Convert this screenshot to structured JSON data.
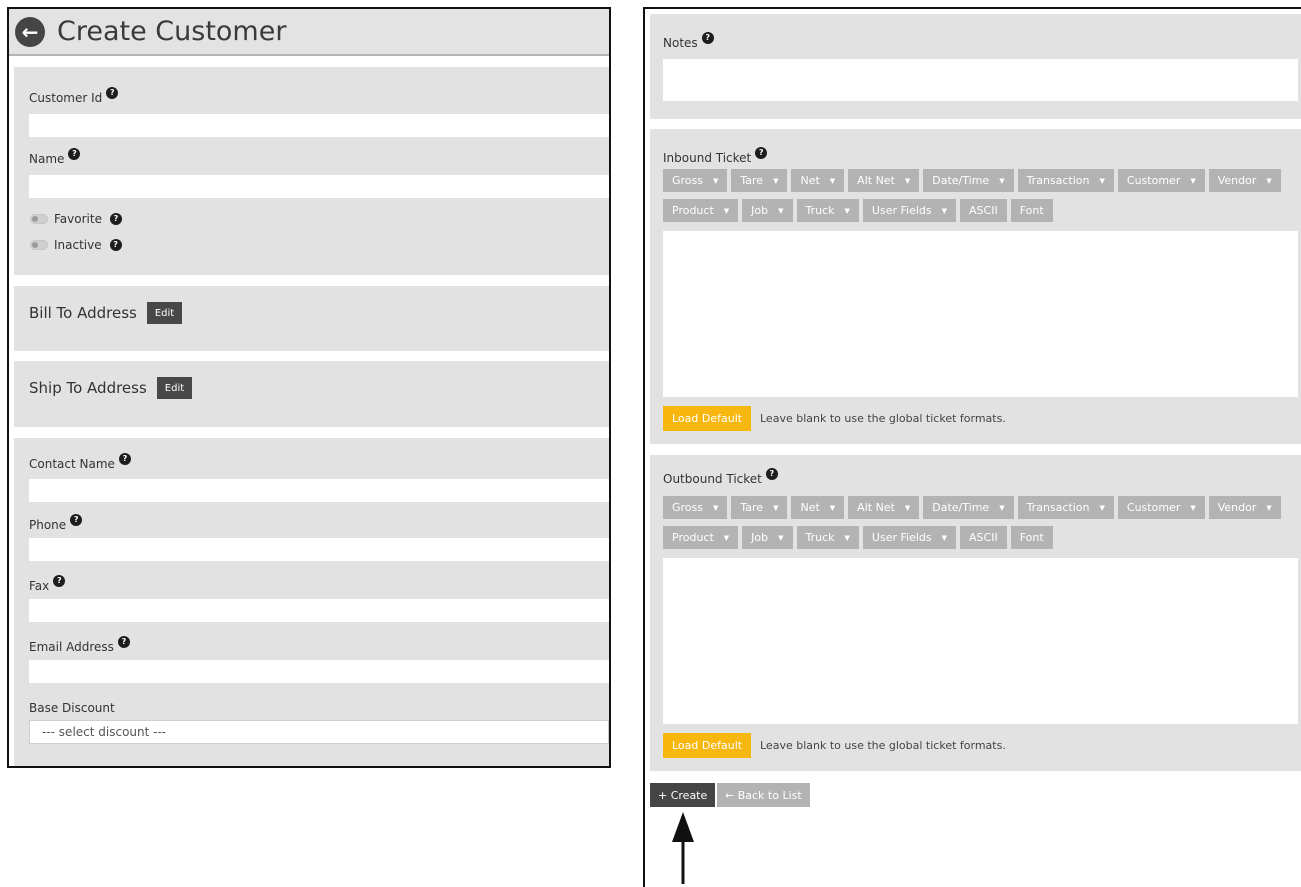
{
  "header": {
    "title": "Create Customer",
    "back_icon": "arrow-left-circle-icon"
  },
  "general": {
    "customer_id_label": "Customer Id",
    "name_label": "Name",
    "favorite_label": "Favorite",
    "inactive_label": "Inactive",
    "customer_id_value": "",
    "name_value": ""
  },
  "bill_to": {
    "title": "Bill To Address",
    "edit_label": "Edit"
  },
  "ship_to": {
    "title": "Ship To Address",
    "edit_label": "Edit"
  },
  "contact": {
    "contact_name_label": "Contact Name",
    "phone_label": "Phone",
    "fax_label": "Fax",
    "email_label": "Email Address",
    "base_discount_label": "Base Discount",
    "discount_selected": "--- select discount ---"
  },
  "notes": {
    "label": "Notes"
  },
  "inbound": {
    "label": "Inbound Ticket",
    "load_default": "Load Default",
    "hint": "Leave blank to use the global ticket formats."
  },
  "outbound": {
    "label": "Outbound Ticket",
    "load_default": "Load Default",
    "hint": "Leave blank to use the global ticket formats."
  },
  "toolbar": {
    "row1": [
      "Gross",
      "Tare",
      "Net",
      "Alt Net",
      "Date/Time",
      "Transaction",
      "Customer",
      "Vendor"
    ],
    "row2": [
      "Product",
      "Job",
      "Truck",
      "User Fields"
    ],
    "ascii": "ASCII",
    "font": "Font"
  },
  "actions": {
    "create": "+ Create",
    "back_to_list": "← Back to List"
  },
  "colors": {
    "load_default": "#f7b70f",
    "toolbar_button": "#b3b3b3",
    "dark_button": "#454545",
    "panel": "#e2e2e2"
  }
}
